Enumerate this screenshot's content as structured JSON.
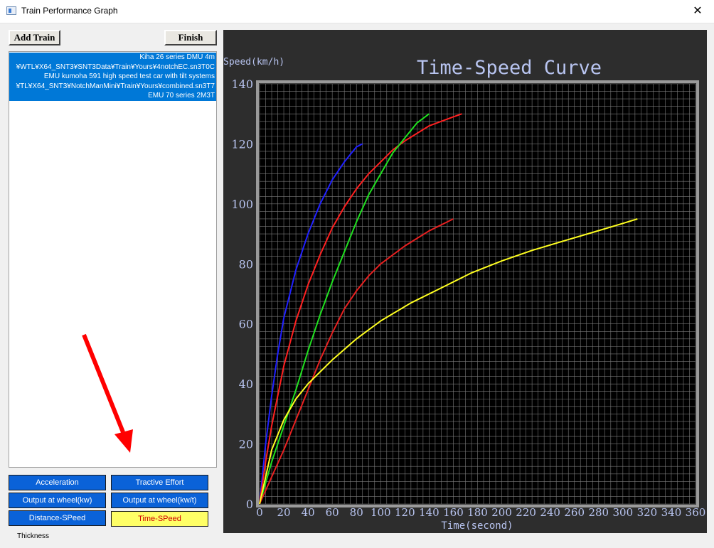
{
  "window": {
    "title": "Train Performance Graph",
    "close_glyph": "✕"
  },
  "toolbar": {
    "add_train": "Add Train",
    "finish": "Finish"
  },
  "train_list": [
    "Kiha 26 series DMU 4m",
    "¥WTL¥X64_SNT3¥SNT3Data¥Train¥Yours¥4notchEC.sn3T0C",
    "EMU kumoha 591 high speed test car with tilt systems",
    "¥TL¥X64_SNT3¥NotchManMini¥Train¥Yours¥combined.sn3T7",
    "EMU 70 series  2M3T"
  ],
  "graph_buttons": {
    "acceleration": "Acceleration",
    "tractive_effort": "Tractive Effort",
    "output_kw": "Output at wheel(kw)",
    "output_kwt": "Output at wheel(kw/t)",
    "distance_speed": "Distance-SPeed",
    "time_speed": "Time-SPeed"
  },
  "thickness_label": "Thickness",
  "colors": {
    "selection": "#0078d7",
    "button_blue": "#0a62d8",
    "button_active": "#ffff66",
    "annotation_arrow": "#ff0000",
    "plot_bg": "#000000",
    "panel_bg": "#2d2d2d"
  },
  "chart_data": {
    "type": "line",
    "title": "Time-Speed Curve",
    "xlabel": "Time(second)",
    "ylabel": "Speed(km/h)",
    "xlim": [
      0,
      360
    ],
    "ylim": [
      0,
      140
    ],
    "x_ticks": [
      0,
      20,
      40,
      60,
      80,
      100,
      120,
      140,
      160,
      180,
      200,
      220,
      240,
      260,
      280,
      300,
      320,
      340,
      360
    ],
    "y_ticks": [
      0,
      20,
      40,
      60,
      80,
      100,
      120,
      140
    ],
    "grid": true,
    "series": [
      {
        "color": "#2020ff",
        "points": [
          [
            0,
            0
          ],
          [
            5,
            20
          ],
          [
            10,
            36
          ],
          [
            15,
            50
          ],
          [
            20,
            62
          ],
          [
            30,
            78
          ],
          [
            40,
            90
          ],
          [
            50,
            100
          ],
          [
            60,
            108
          ],
          [
            70,
            114
          ],
          [
            80,
            119
          ],
          [
            85,
            120
          ]
        ]
      },
      {
        "color": "#ff2020",
        "points": [
          [
            0,
            0
          ],
          [
            5,
            14
          ],
          [
            10,
            26
          ],
          [
            15,
            36
          ],
          [
            20,
            46
          ],
          [
            30,
            61
          ],
          [
            40,
            73
          ],
          [
            50,
            83
          ],
          [
            60,
            92
          ],
          [
            70,
            99
          ],
          [
            80,
            105
          ],
          [
            90,
            110
          ],
          [
            100,
            114
          ],
          [
            110,
            118
          ],
          [
            120,
            121
          ],
          [
            140,
            126
          ],
          [
            160,
            129
          ],
          [
            167,
            130
          ]
        ]
      },
      {
        "color": "#20e020",
        "points": [
          [
            0,
            0
          ],
          [
            10,
            14
          ],
          [
            20,
            26
          ],
          [
            30,
            38
          ],
          [
            40,
            51
          ],
          [
            50,
            63
          ],
          [
            60,
            74
          ],
          [
            70,
            84
          ],
          [
            80,
            94
          ],
          [
            90,
            103
          ],
          [
            100,
            110
          ],
          [
            110,
            117
          ],
          [
            120,
            122
          ],
          [
            130,
            127
          ],
          [
            140,
            130
          ]
        ]
      },
      {
        "color": "#e82020",
        "points": [
          [
            0,
            0
          ],
          [
            10,
            9
          ],
          [
            20,
            18
          ],
          [
            30,
            28
          ],
          [
            40,
            38
          ],
          [
            50,
            48
          ],
          [
            60,
            57
          ],
          [
            70,
            65
          ],
          [
            80,
            71
          ],
          [
            90,
            76
          ],
          [
            100,
            80
          ],
          [
            120,
            86
          ],
          [
            140,
            91
          ],
          [
            160,
            95
          ]
        ]
      },
      {
        "color": "#ffff20",
        "points": [
          [
            0,
            0
          ],
          [
            10,
            18
          ],
          [
            20,
            28
          ],
          [
            30,
            35
          ],
          [
            40,
            40
          ],
          [
            60,
            48
          ],
          [
            80,
            55
          ],
          [
            100,
            61
          ],
          [
            125,
            67
          ],
          [
            150,
            72
          ],
          [
            175,
            77
          ],
          [
            200,
            81
          ],
          [
            225,
            84.5
          ],
          [
            250,
            87.5
          ],
          [
            275,
            90.5
          ],
          [
            300,
            93.5
          ],
          [
            312,
            95
          ]
        ]
      }
    ]
  }
}
